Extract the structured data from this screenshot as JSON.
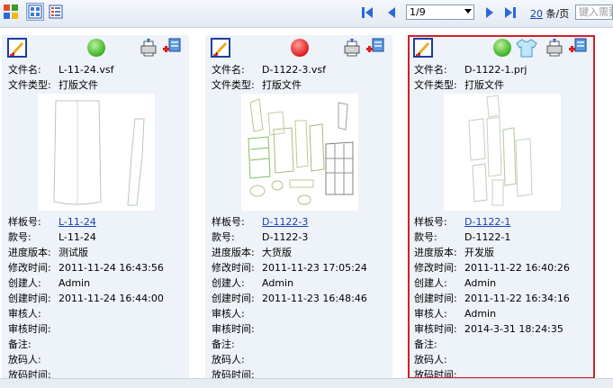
{
  "toolbar": {
    "page_select": "1/9",
    "per_page_count": "20",
    "per_page_unit": "条/页",
    "search_placeholder": "键入需要"
  },
  "cards": [
    {
      "filename_label": "文件名:",
      "filename": "L-11-24.vsf",
      "filetype_label": "文件类型:",
      "filetype": "打版文件",
      "status": "green",
      "rows": [
        {
          "label": "样板号:",
          "value": "L-11-24",
          "link": true
        },
        {
          "label": "款号:",
          "value": "L-11-24"
        },
        {
          "label": "进度版本:",
          "value": "测试版"
        },
        {
          "label": "修改时间:",
          "value": "2011-11-24 16:43:56"
        },
        {
          "label": "创建人:",
          "value": "Admin"
        },
        {
          "label": "创建时间:",
          "value": "2011-11-24 16:44:00"
        },
        {
          "label": "审核人:",
          "value": ""
        },
        {
          "label": "审核时间:",
          "value": ""
        },
        {
          "label": "备注:",
          "value": ""
        },
        {
          "label": "放码人:",
          "value": ""
        },
        {
          "label": "放码时间:",
          "value": ""
        }
      ]
    },
    {
      "filename_label": "文件名:",
      "filename": "D-1122-3.vsf",
      "filetype_label": "文件类型:",
      "filetype": "打版文件",
      "status": "red",
      "rows": [
        {
          "label": "样板号:",
          "value": "D-1122-3",
          "link": true
        },
        {
          "label": "款号:",
          "value": "D-1122-3"
        },
        {
          "label": "进度版本:",
          "value": "大货版"
        },
        {
          "label": "修改时间:",
          "value": "2011-11-23 17:05:24"
        },
        {
          "label": "创建人:",
          "value": "Admin"
        },
        {
          "label": "创建时间:",
          "value": "2011-11-23 16:48:46"
        },
        {
          "label": "审核人:",
          "value": ""
        },
        {
          "label": "审核时间:",
          "value": ""
        },
        {
          "label": "备注:",
          "value": ""
        },
        {
          "label": "放码人:",
          "value": ""
        },
        {
          "label": "放码时间:",
          "value": ""
        }
      ]
    },
    {
      "filename_label": "文件名:",
      "filename": "D-1122-1.prj",
      "filetype_label": "文件类型:",
      "filetype": "打版文件",
      "status": "green",
      "rows": [
        {
          "label": "样板号:",
          "value": "D-1122-1",
          "link": true
        },
        {
          "label": "款号:",
          "value": "D-1122-1"
        },
        {
          "label": "进度版本:",
          "value": "开发版"
        },
        {
          "label": "修改时间:",
          "value": "2011-11-22 16:40:26"
        },
        {
          "label": "创建人:",
          "value": "Admin"
        },
        {
          "label": "创建时间:",
          "value": "2011-11-22 16:34:16"
        },
        {
          "label": "审核人:",
          "value": "Admin"
        },
        {
          "label": "审核时间:",
          "value": "2014-3-31 18:24:35"
        },
        {
          "label": "备注:",
          "value": ""
        },
        {
          "label": "放码人:",
          "value": ""
        },
        {
          "label": "放码时间:",
          "value": ""
        }
      ]
    }
  ],
  "colors": {
    "accent_link": "#1a3fb0",
    "selected_border": "#d0202a",
    "status_green": "#3cc020",
    "status_red": "#e01818",
    "card_bg": "#eef2f9"
  },
  "icons": [
    "app-grid-icon",
    "thumbnail-view-icon",
    "list-view-icon",
    "first-page-icon",
    "prev-page-icon",
    "next-page-icon",
    "last-page-icon",
    "edit-pencil-icon",
    "status-indicator-icon",
    "shirt-icon",
    "plotter-icon",
    "transfer-icon"
  ]
}
